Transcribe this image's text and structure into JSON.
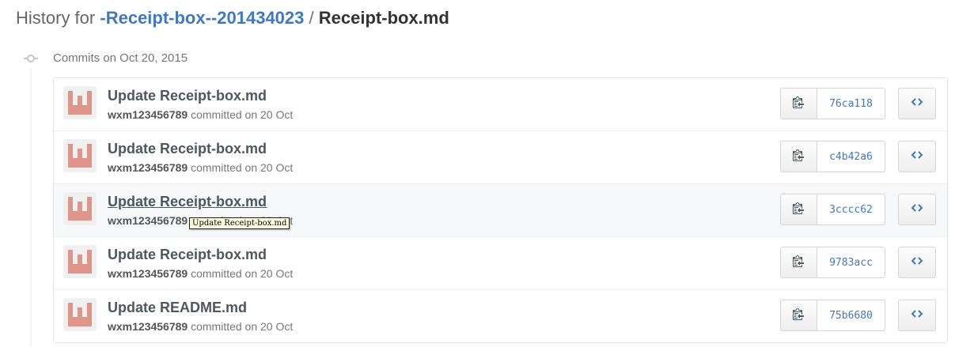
{
  "header": {
    "prefix": "History for",
    "repo": "-Receipt-box--201434023",
    "separator": "/",
    "file": "Receipt-box.md"
  },
  "group": {
    "title": "Commits on Oct 20, 2015"
  },
  "tooltip": "Update Receipt-box.md",
  "commits": [
    {
      "title": "Update Receipt-box.md",
      "author": "wxm123456789",
      "committed": "committed on 20 Oct",
      "sha": "76ca118"
    },
    {
      "title": "Update Receipt-box.md",
      "author": "wxm123456789",
      "committed": "committed on 20 Oct",
      "sha": "c4b42a6"
    },
    {
      "title": "Update Receipt-box.md",
      "author": "wxm123456789",
      "committed": "committed on 20 Oct",
      "sha": "3cccc62"
    },
    {
      "title": "Update Receipt-box.md",
      "author": "wxm123456789",
      "committed": "committed on 20 Oct",
      "sha": "9783acc"
    },
    {
      "title": "Update README.md",
      "author": "wxm123456789",
      "committed": "committed on 20 Oct",
      "sha": "75b6680"
    }
  ],
  "icons": {
    "copy": "clippy-icon",
    "browse": "code-icon",
    "timeline": "git-commit-icon"
  },
  "colors": {
    "link": "#4078c0",
    "avatar": "#e0958a"
  }
}
